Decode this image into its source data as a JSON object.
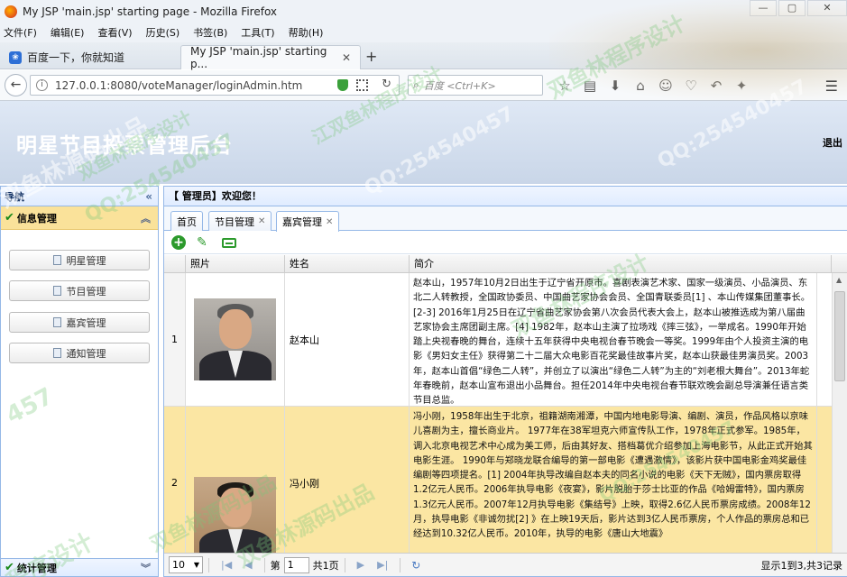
{
  "browser": {
    "window_title": "My JSP 'main.jsp' starting page - Mozilla Firefox",
    "window_buttons": [
      "—",
      "▢",
      "✕"
    ],
    "menu": [
      "文件(F)",
      "编辑(E)",
      "查看(V)",
      "历史(S)",
      "书签(B)",
      "工具(T)",
      "帮助(H)"
    ],
    "tabs": [
      {
        "label": "百度一下，你就知道"
      },
      {
        "label": "My JSP 'main.jsp' starting p..."
      }
    ],
    "url": "127.0.0.1:8080/voteManager/loginAdmin.htm",
    "search_placeholder": "百度 <Ctrl+K>"
  },
  "app": {
    "title": "明星节目投票管理后台",
    "logout": "退出"
  },
  "sidebar": {
    "header": "导航",
    "group": "信息管理",
    "items": [
      {
        "label": "明星管理"
      },
      {
        "label": "节目管理"
      },
      {
        "label": "嘉宾管理"
      },
      {
        "label": "通知管理"
      }
    ],
    "stats_group": "统计管理"
  },
  "main": {
    "welcome": "【 管理员】欢迎您！",
    "tabs": [
      {
        "label": "首页"
      },
      {
        "label": "节目管理"
      },
      {
        "label": "嘉宾管理"
      }
    ],
    "columns": [
      "照片",
      "姓名",
      "简介"
    ],
    "rows": [
      {
        "num": "1",
        "name": "赵本山",
        "intro": "赵本山，1957年10月2日出生于辽宁省开原市。喜剧表演艺术家、国家一级演员、小品演员、东北二人转教授，全国政协委员、中国曲艺家协会会员、全国青联委员[1] 、本山传媒集团董事长。[2-3] 2016年1月25日在辽宁省曲艺家协会第八次会员代表大会上，赵本山被推选成为第八届曲艺家协会主席团副主席。[4] 1982年，赵本山主演了拉场戏《摔三弦》，一举成名。1990年开始踏上央视春晚的舞台，连续十五年获得中央电视台春节晚会一等奖。1999年由个人投资主演的电影《男妇女主任》获得第二十二届大众电影百花奖最佳故事片奖，赵本山获最佳男演员奖。2003年，赵本山首倡“绿色二人转”，并创立了以演出“绿色二人转”为主的“刘老根大舞台”。2013年蛇年春晚前，赵本山宣布退出小品舞台。担任2014年中央电视台春节联欢晚会副总导演兼任语言类节目总监。"
      },
      {
        "num": "2",
        "name": "冯小刚",
        "intro": "冯小刚，1958年出生于北京，祖籍湖南湘潭，中国内地电影导演、编剧、演员，作品风格以京味儿喜剧为主，擅长商业片。 1977年在38军坦克六师宣传队工作，1978年正式参军。1985年，调入北京电视艺术中心成为美工师，后由其好友、搭档葛优介绍参加上海电影节，从此正式开始其电影生涯。 1990年与郑晓龙联合编导的第一部电影《遭遇激情》，该影片获中国电影金鸡奖最佳编剧等四项提名。[1] 2004年执导改编自赵本夫的同名小说的电影《天下无贼》，国内票房取得1.2亿元人民币。2006年执导电影《夜宴》，影片脱胎于莎士比亚的作品《哈姆雷特》，国内票房1.3亿元人民币。2007年12月执导电影《集结号》上映，取得2.6亿人民币票房成绩。2008年12月，执导电影《非诚勿扰[2] 》在上映19天后，影片达到3亿人民币票房，个人作品的票房总和已经达到10.32亿人民币。2010年，执导的电影《唐山大地震》"
      }
    ]
  },
  "pager": {
    "page_size": "10",
    "page_label": "第",
    "page_value": "1",
    "total_pages": "共1页",
    "info": "显示1到3,共3记录"
  },
  "watermarks": [
    "双鱼林源码出品",
    "双鱼林程序设计",
    "QQ:254540457",
    "双鱼林源码出品",
    "双鱼林程序设计",
    "QQ:254540457",
    "双鱼林源码出品",
    "双鱼林程序设计",
    "QQ:254540457",
    "江双鱼林程序设计",
    "QQ:254540457",
    "程序设计",
    "457"
  ],
  "colors": {
    "header_bg": "#c9d6e8",
    "panel_border": "#95b8e7",
    "highlight_row": "#fbe6a3",
    "group_header": "#fae29a",
    "toolbar_green": "#2c9a2c"
  }
}
